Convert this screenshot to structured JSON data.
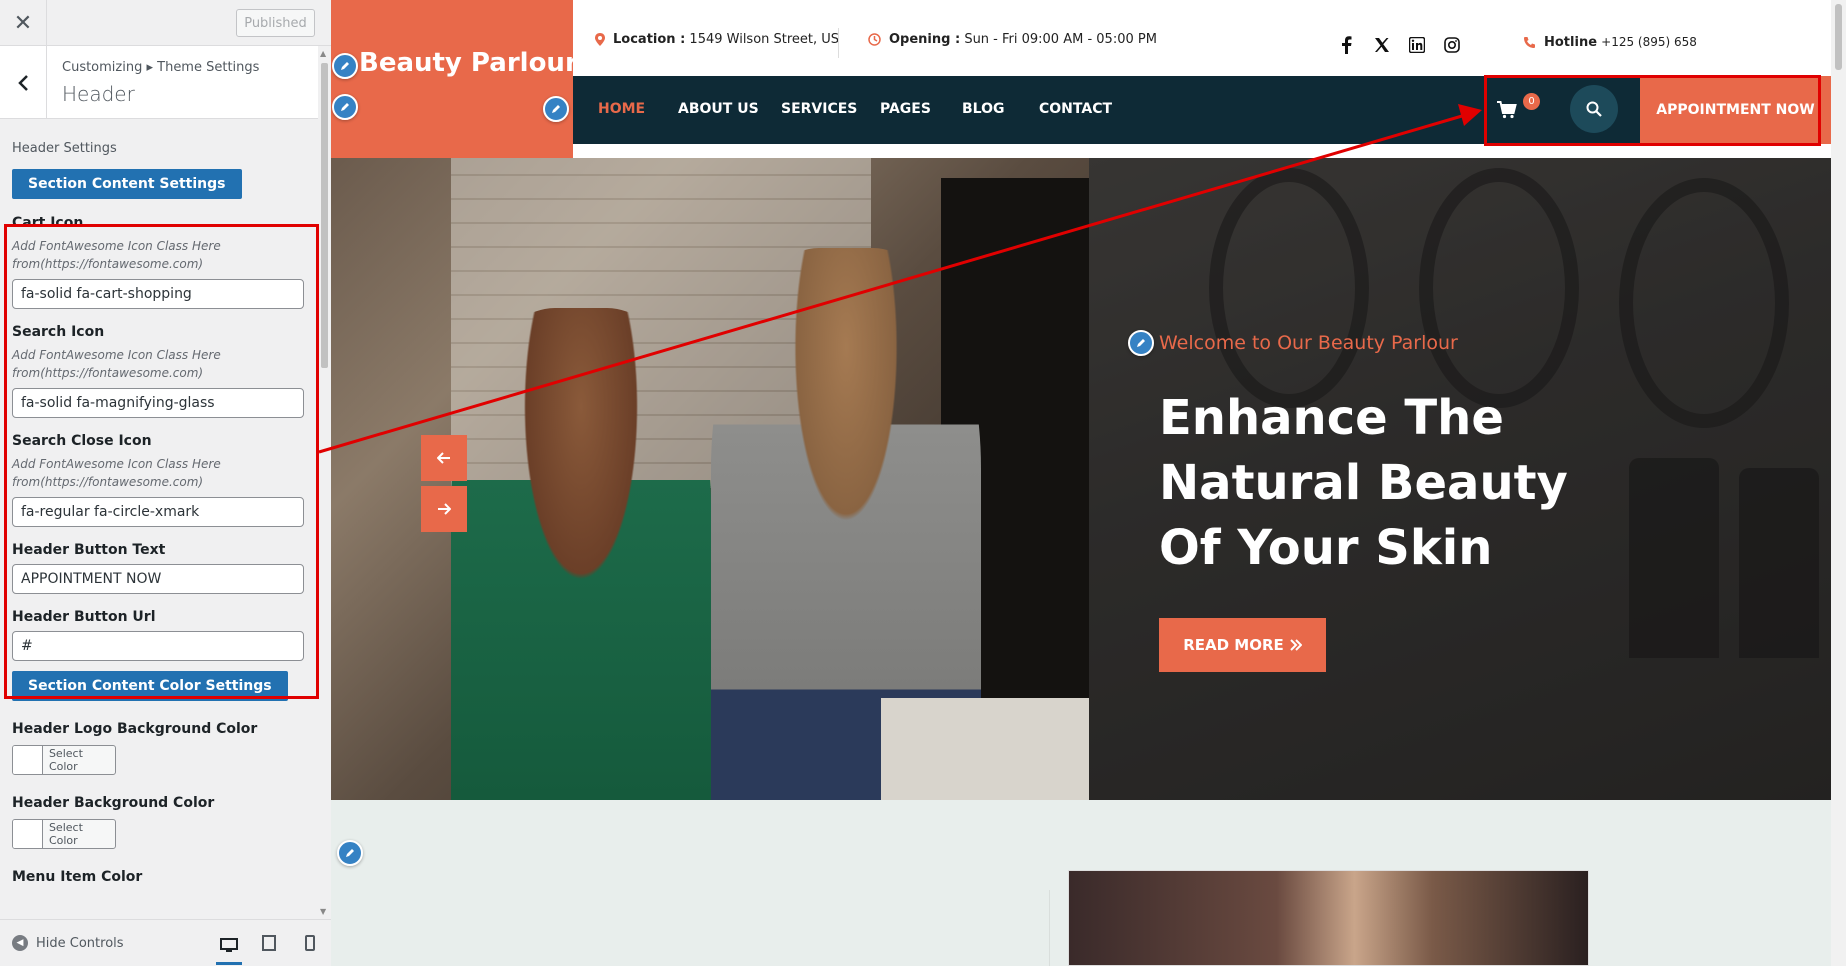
{
  "sidebar": {
    "close_label": "✕",
    "published_label": "Published",
    "breadcrumb": "Customizing ▸ Theme Settings",
    "section_title": "Header",
    "group_title": "Header Settings",
    "content_settings_label": "Section Content Settings",
    "color_settings_label": "Section Content Color Settings",
    "controls": [
      {
        "label": "Cart Icon",
        "desc": "Add FontAwesome Icon Class Here from(https://fontawesome.com)",
        "value": "fa-solid fa-cart-shopping"
      },
      {
        "label": "Search Icon",
        "desc": "Add FontAwesome Icon Class Here from(https://fontawesome.com)",
        "value": "fa-solid fa-magnifying-glass"
      },
      {
        "label": "Search Close Icon",
        "desc": "Add FontAwesome Icon Class Here from(https://fontawesome.com)",
        "value": "fa-regular fa-circle-xmark"
      },
      {
        "label": "Header Button Text",
        "value": "APPOINTMENT NOW"
      },
      {
        "label": "Header Button Url",
        "value": "#"
      }
    ],
    "color_controls": [
      {
        "label": "Header Logo Background Color",
        "button": "Select Color"
      },
      {
        "label": "Header Background Color",
        "button": "Select Color"
      },
      {
        "label": "Menu Item Color"
      }
    ],
    "hide_controls_label": "Hide Controls"
  },
  "site": {
    "logo": "Beauty Parlour",
    "location_label": "Location :",
    "location_value": "1549 Wilson Street, US",
    "opening_label": "Opening :",
    "opening_value": "Sun - Fri 09:00 AM - 05:00 PM",
    "hotline_label": "Hotline",
    "hotline_value": "+125 (895) 658",
    "social_icons": [
      "facebook-icon",
      "x-icon",
      "linkedin-icon",
      "instagram-icon"
    ],
    "nav": [
      {
        "label": "HOME",
        "active": true
      },
      {
        "label": "ABOUT US"
      },
      {
        "label": "SERVICES"
      },
      {
        "label": "PAGES"
      },
      {
        "label": "BLOG"
      },
      {
        "label": "CONTACT"
      }
    ],
    "cart_count": "0",
    "appointment_label": "APPOINTMENT NOW",
    "hero": {
      "welcome": "Welcome to Our Beauty Parlour",
      "heading": "Enhance The Natural Beauty Of Your Skin",
      "button": "READ MORE"
    }
  },
  "colors": {
    "accent": "#e8694a",
    "nav_bg": "#0e2a36",
    "wp_blue": "#2271b1",
    "annotation_red": "#e00000"
  }
}
